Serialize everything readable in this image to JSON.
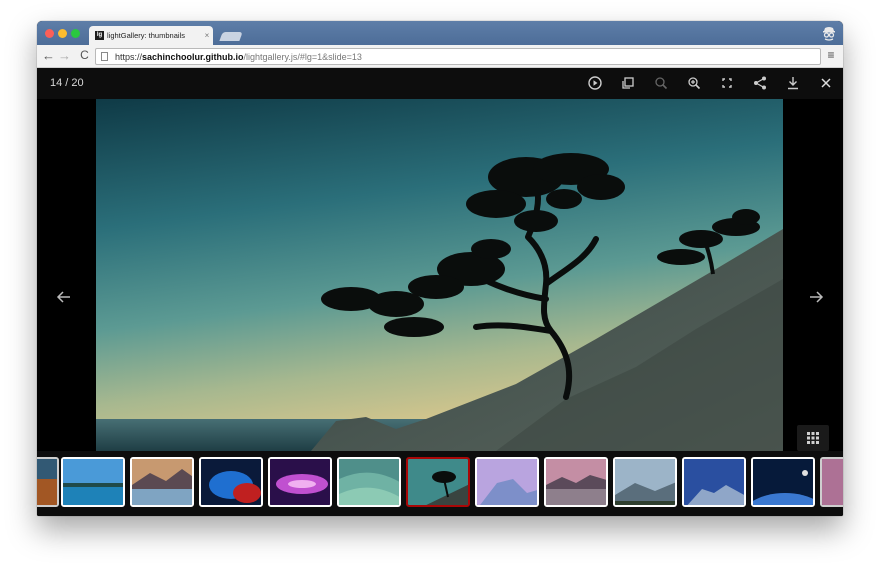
{
  "browser": {
    "tab_title": "lightGallery: thumbnails",
    "tab_favicon": "lg",
    "tab_close": "×",
    "url_scheme": "https://",
    "url_host": "sachinchoolur.github.io",
    "url_path": "/lightgallery.js/#lg=1&slide=13",
    "icons": [
      "back-icon",
      "forward-icon",
      "reload-icon",
      "page-icon",
      "menu-icon",
      "profile-icon"
    ]
  },
  "gallery": {
    "counter": "14 / 20",
    "current_slide": 14,
    "total_slides": 20,
    "toolbar_icons": [
      "autoplay-icon",
      "fullscreen-icon",
      "zoom-out-icon",
      "zoom-in-icon",
      "actual-size-icon",
      "share-icon",
      "download-icon",
      "close-icon"
    ],
    "nav_icons": [
      "arrow-left-icon",
      "arrow-right-icon"
    ],
    "thumbnails": [
      {
        "subject": "partial",
        "active": false
      },
      {
        "subject": "lake",
        "active": false
      },
      {
        "subject": "mountain-lake-sunset",
        "active": false
      },
      {
        "subject": "abstract-blue-red",
        "active": false
      },
      {
        "subject": "aurora-purple",
        "active": false
      },
      {
        "subject": "green-waves",
        "active": false
      },
      {
        "subject": "tree-on-hill",
        "active": true
      },
      {
        "subject": "half-dome-purple",
        "active": false
      },
      {
        "subject": "rocky-lake-pink",
        "active": false
      },
      {
        "subject": "mountain-mist",
        "active": false
      },
      {
        "subject": "mountain-blue",
        "active": false
      },
      {
        "subject": "earth-from-space",
        "active": false
      },
      {
        "subject": "partial-pink",
        "active": false
      }
    ],
    "colors": {
      "active_border": "#a90707",
      "thumb_border": "#ffffff",
      "background": "#000000"
    }
  }
}
